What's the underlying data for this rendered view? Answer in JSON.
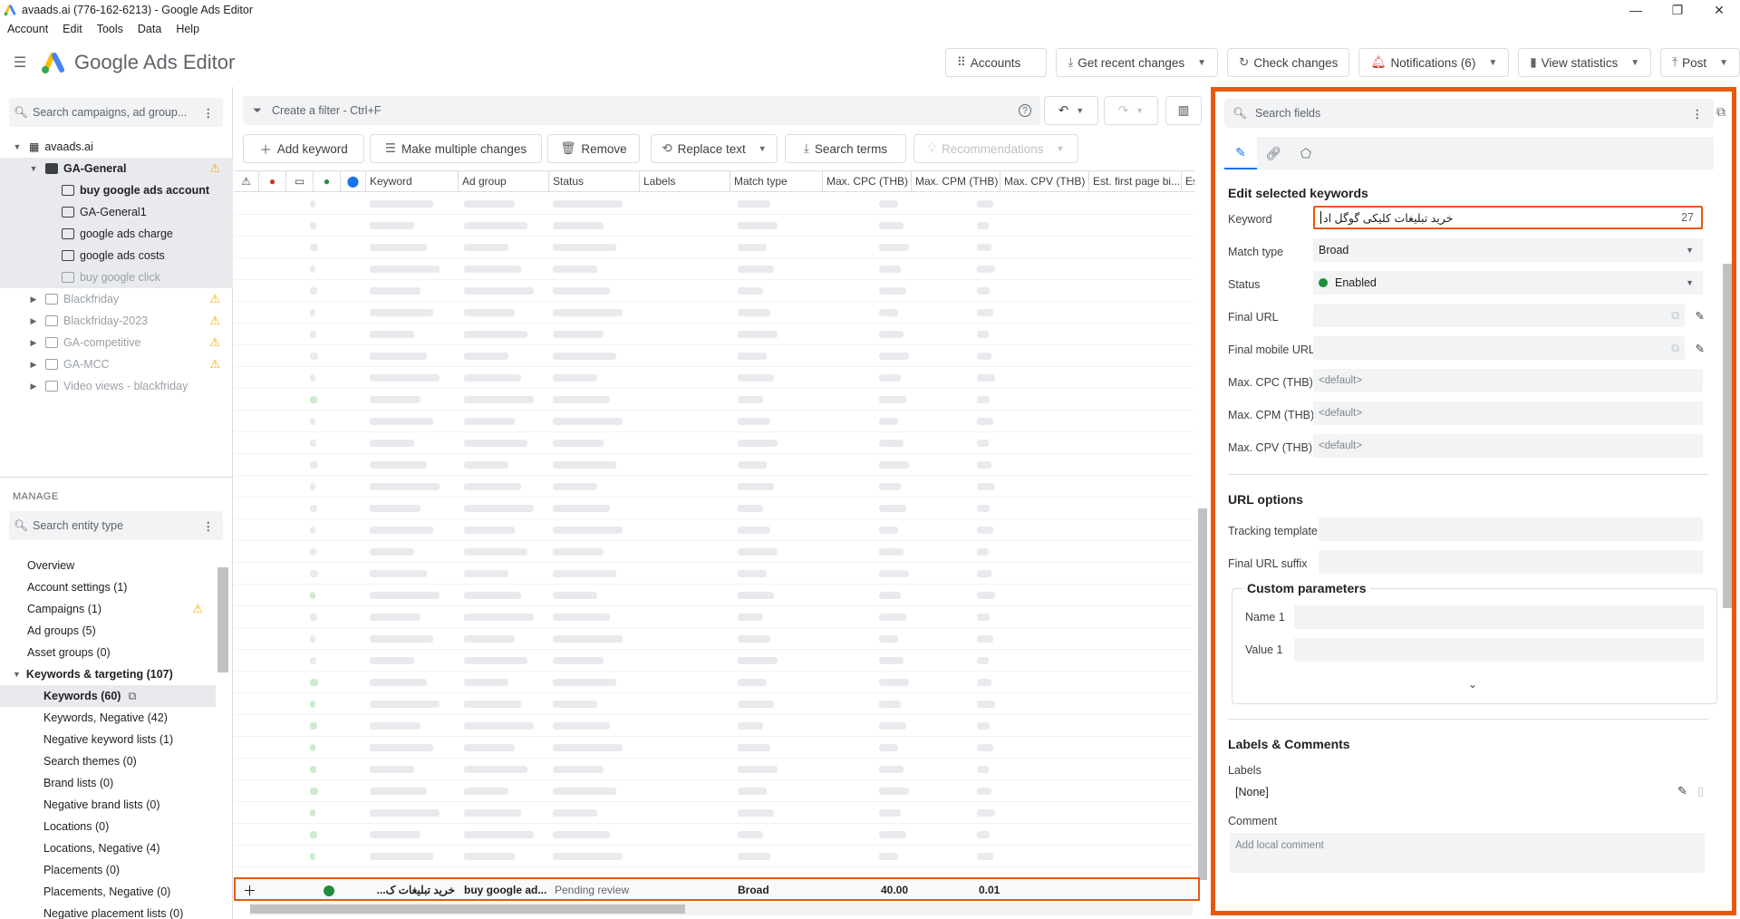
{
  "window": {
    "title": "avaads.ai (776-162-6213) - Google Ads Editor"
  },
  "menu": [
    "Account",
    "Edit",
    "Tools",
    "Data",
    "Help"
  ],
  "header": {
    "brand": "Google Ads Editor",
    "buttons": {
      "accounts": "Accounts",
      "get_recent": "Get recent changes",
      "check": "Check changes",
      "notifications": "Notifications (6)",
      "view_stats": "View statistics",
      "post": "Post"
    }
  },
  "left": {
    "search_placeholder": "Search campaigns, ad group...",
    "account": "avaads.ai",
    "campaign_open": "GA-General",
    "ad_groups": [
      "buy google ads account",
      "GA-General1",
      "google ads charge",
      "google ads costs",
      "buy google click"
    ],
    "campaigns": [
      "Blackfriday",
      "Blackfriday-2023",
      "GA-competitive",
      "GA-MCC",
      "Video views - blackfriday"
    ],
    "manage_label": "MANAGE",
    "entity_search_placeholder": "Search entity type",
    "manage": {
      "overview": "Overview",
      "account_settings": "Account settings (1)",
      "campaigns": "Campaigns (1)",
      "ad_groups": "Ad groups (5)",
      "asset_groups": "Asset groups (0)",
      "kw_targeting": "Keywords & targeting (107)",
      "keywords": "Keywords (60)",
      "kw_negative": "Keywords, Negative (42)",
      "neg_kw_lists": "Negative keyword lists (1)",
      "search_themes": "Search themes (0)",
      "brand_lists": "Brand lists (0)",
      "neg_brand_lists": "Negative brand lists (0)",
      "locations": "Locations (0)",
      "locations_neg": "Locations, Negative (4)",
      "placements": "Placements (0)",
      "placements_neg": "Placements, Negative (0)",
      "neg_placement_lists": "Negative placement lists (0)"
    }
  },
  "center": {
    "filter_placeholder": "Create a filter - Ctrl+F",
    "toolbar": {
      "add_keyword": "Add keyword",
      "make_multiple": "Make multiple changes",
      "remove": "Remove",
      "replace_text": "Replace text",
      "search_terms": "Search terms",
      "recommendations": "Recommendations"
    },
    "columns": {
      "keyword": "Keyword",
      "ad_group": "Ad group",
      "status": "Status",
      "labels": "Labels",
      "match_type": "Match type",
      "max_cpc": "Max. CPC (THB)",
      "max_cpm": "Max. CPM (THB)",
      "max_cpv": "Max. CPV (THB)",
      "est_first": "Est. first page bi...",
      "es": "Es"
    },
    "new_row": {
      "keyword": "خرید تبلیغات ک...",
      "ad_group": "buy google ad...",
      "status": "Pending review",
      "match_type": "Broad",
      "max_cpc": "40.00",
      "max_cpm": "0.01"
    }
  },
  "right": {
    "search_placeholder": "Search fields",
    "edit_title": "Edit selected keywords",
    "fields": {
      "keyword_label": "Keyword",
      "keyword_value": "خرید تبلیغات کلیکی گوگل اد",
      "keyword_count": "27",
      "match_type_label": "Match type",
      "match_type_value": "Broad",
      "status_label": "Status",
      "status_value": "Enabled",
      "final_url_label": "Final URL",
      "final_mobile_label": "Final mobile URL",
      "max_cpc_label": "Max. CPC (THB)",
      "max_cpm_label": "Max. CPM (THB)",
      "max_cpv_label": "Max. CPV (THB)",
      "default": "<default>"
    },
    "url_options": {
      "title": "URL options",
      "tracking": "Tracking template",
      "suffix": "Final URL suffix"
    },
    "custom_params": {
      "title": "Custom parameters",
      "name1": "Name 1",
      "value1": "Value 1"
    },
    "labels_comments": {
      "title": "Labels & Comments",
      "labels": "Labels",
      "labels_value": "[None]",
      "comment": "Comment",
      "comment_placeholder": "Add local comment"
    }
  },
  "colors": {
    "accent": "#1a73e8",
    "highlight": "#e8590c",
    "warning": "#f9ab00",
    "enabled": "#1e8e3e"
  }
}
